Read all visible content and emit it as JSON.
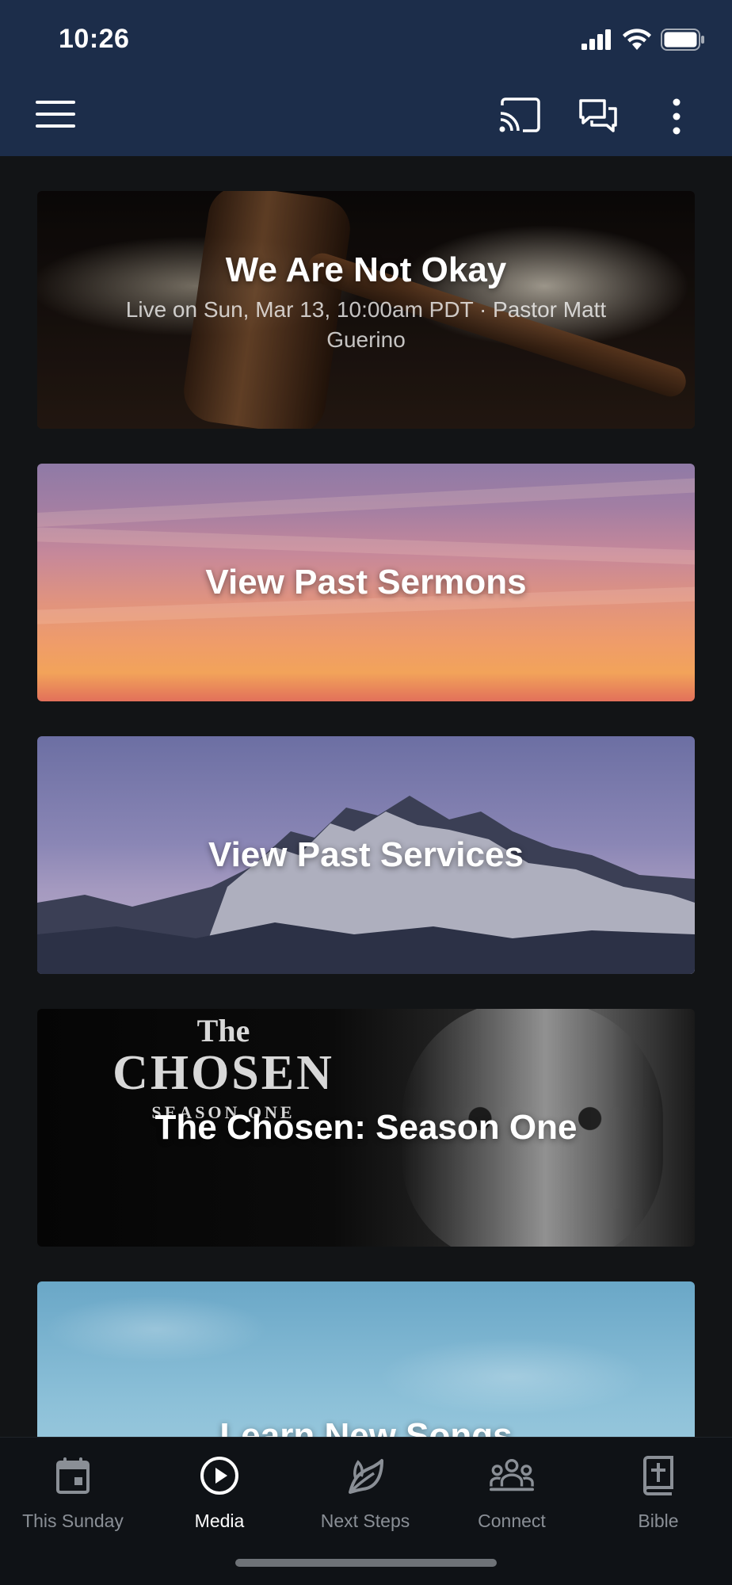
{
  "status_bar": {
    "time": "10:26",
    "icons": [
      "cellular-signal-icon",
      "wifi-icon",
      "battery-icon"
    ]
  },
  "header": {
    "icons": [
      "hamburger-menu-icon",
      "cast-icon",
      "chat-icon",
      "more-vertical-icon"
    ]
  },
  "feed": {
    "cards": [
      {
        "title": "We Are Not Okay",
        "subtitle": "Live on Sun, Mar 13, 10:00am PDT · Pastor Matt Guerino"
      },
      {
        "title": "View Past Sermons"
      },
      {
        "title": "View Past Services"
      },
      {
        "title": "The Chosen: Season One",
        "logo_text": {
          "the": "The",
          "main": "CHOSEN",
          "season": "SEASON ONE"
        }
      },
      {
        "title": "Learn New Songs"
      }
    ]
  },
  "tabbar": {
    "active": "Media",
    "tabs": [
      {
        "label": "This Sunday",
        "icon": "calendar-icon"
      },
      {
        "label": "Media",
        "icon": "play-circle-icon"
      },
      {
        "label": "Next Steps",
        "icon": "leaf-icon"
      },
      {
        "label": "Connect",
        "icon": "people-group-icon"
      },
      {
        "label": "Bible",
        "icon": "bible-icon"
      }
    ]
  },
  "colors": {
    "header_bg": "#1c2d4a",
    "page_bg": "#121416",
    "tab_inactive": "#8a8f96",
    "tab_active": "#ffffff"
  }
}
